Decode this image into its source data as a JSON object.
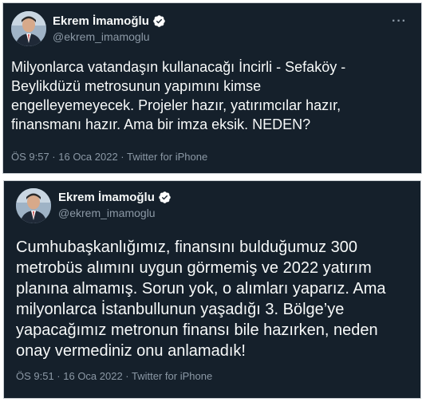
{
  "tweets": [
    {
      "author_name": "Ekrem İmamoğlu",
      "author_handle": "@ekrem_imamoglu",
      "more_label": "···",
      "text": "Milyonlarca vatandaşın kullanacağı İncirli - Sefaköy -\nBeylikdüzü metrosunun yapımını kimse\nengelleyemeyecek. Projeler hazır, yatırımcılar hazır,\nfinansmanı hazır. Ama bir imza eksik. NEDEN?",
      "meta": "ÖS 9:57 · 16 Oca 2022 · Twitter for iPhone"
    },
    {
      "author_name": "Ekrem İmamoğlu",
      "author_handle": "@ekrem_imamoglu",
      "text": "Cumhubaşkanlığımız, finansını bulduğumuz 300\nmetrobüs alımını uygun görmemiş ve 2022 yatırım\nplanına almamış. Sorun yok, o alımları yaparız. Ama\nmilyonlarca İstanbullunun yaşadığı 3. Bölge’ye\nyapacağımız metronun finansı bile hazırken, neden\nonay vermediniz onu anlamadık!",
      "meta": "ÖS 9:51 · 16 Oca 2022 · Twitter for iPhone"
    }
  ],
  "colors": {
    "background": "#15202b",
    "text": "#f7f9f9",
    "secondary_text": "#8b98a5",
    "verified": "#ffffff"
  },
  "icons": {
    "verified": "verified-badge-icon",
    "more": "more-options-icon"
  }
}
